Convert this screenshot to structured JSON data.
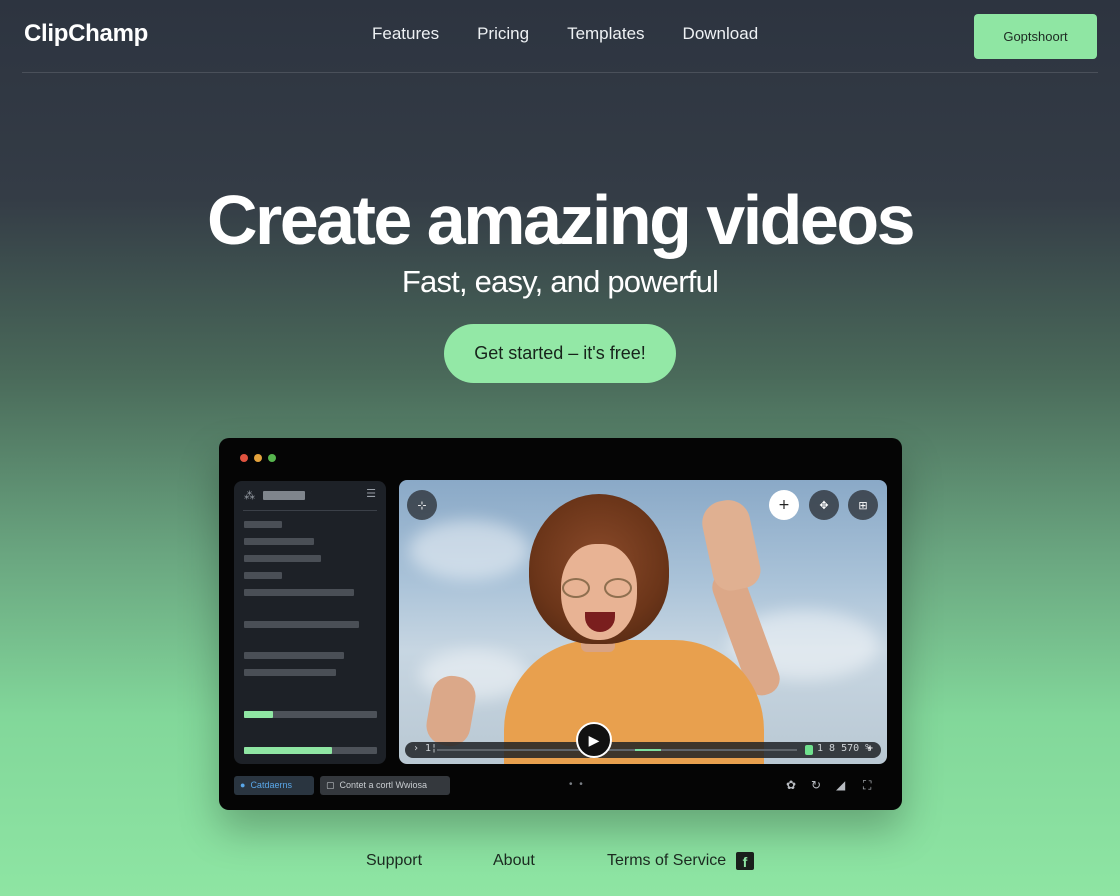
{
  "brand": {
    "name": "ClipChamp"
  },
  "nav": {
    "links": [
      "Features",
      "Pricing",
      "Templates",
      "Download"
    ],
    "cta": "Goptshoort"
  },
  "hero": {
    "title": "Create amazing videos",
    "subtitle": "Fast, easy, and powerful",
    "cta": "Get started – it's free!"
  },
  "app_preview": {
    "window_controls": [
      "close",
      "minimize",
      "maximize"
    ],
    "sidebar": {
      "icons": {
        "left": "sparkle-icon",
        "right": "menu-icon"
      },
      "progress": [
        0.22,
        0.66
      ]
    },
    "preview": {
      "top_buttons": [
        "crop-icon",
        "add-icon",
        "move-icon",
        "grid-icon"
      ],
      "timeline": {
        "left_text": "› 1¦",
        "right_text": "1 8 570 %",
        "add_symbol": "+"
      },
      "play_symbol": "▶"
    },
    "toolbar": {
      "chip_primary": "Catdaerns",
      "chip_secondary": "Contet a cortl Wwiosa",
      "pager": "• •",
      "icons": [
        "settings-icon",
        "refresh-icon",
        "signal-icon",
        "fullscreen-icon"
      ]
    }
  },
  "footer": {
    "links": [
      "Support",
      "About",
      "Terms of Service"
    ],
    "social": "facebook-icon"
  }
}
